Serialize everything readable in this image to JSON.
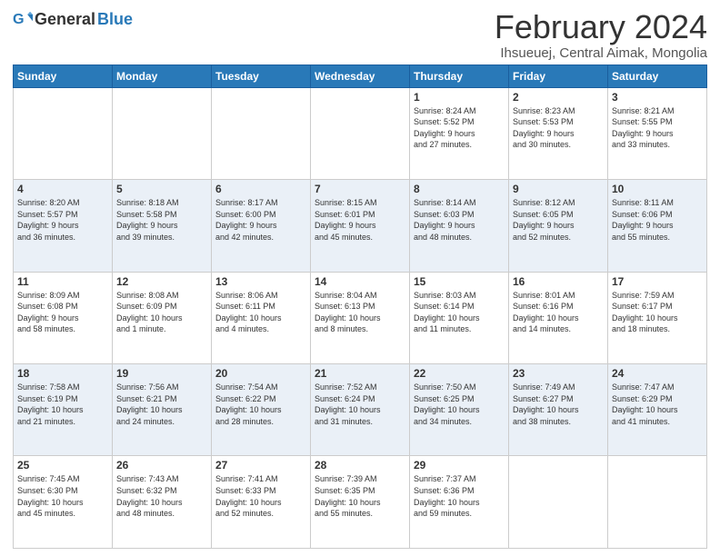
{
  "logo": {
    "general": "General",
    "blue": "Blue"
  },
  "header": {
    "title": "February 2024",
    "subtitle": "Ihsueuej, Central Aimak, Mongolia"
  },
  "weekdays": [
    "Sunday",
    "Monday",
    "Tuesday",
    "Wednesday",
    "Thursday",
    "Friday",
    "Saturday"
  ],
  "weeks": [
    [
      {
        "day": "",
        "info": ""
      },
      {
        "day": "",
        "info": ""
      },
      {
        "day": "",
        "info": ""
      },
      {
        "day": "",
        "info": ""
      },
      {
        "day": "1",
        "info": "Sunrise: 8:24 AM\nSunset: 5:52 PM\nDaylight: 9 hours\nand 27 minutes."
      },
      {
        "day": "2",
        "info": "Sunrise: 8:23 AM\nSunset: 5:53 PM\nDaylight: 9 hours\nand 30 minutes."
      },
      {
        "day": "3",
        "info": "Sunrise: 8:21 AM\nSunset: 5:55 PM\nDaylight: 9 hours\nand 33 minutes."
      }
    ],
    [
      {
        "day": "4",
        "info": "Sunrise: 8:20 AM\nSunset: 5:57 PM\nDaylight: 9 hours\nand 36 minutes."
      },
      {
        "day": "5",
        "info": "Sunrise: 8:18 AM\nSunset: 5:58 PM\nDaylight: 9 hours\nand 39 minutes."
      },
      {
        "day": "6",
        "info": "Sunrise: 8:17 AM\nSunset: 6:00 PM\nDaylight: 9 hours\nand 42 minutes."
      },
      {
        "day": "7",
        "info": "Sunrise: 8:15 AM\nSunset: 6:01 PM\nDaylight: 9 hours\nand 45 minutes."
      },
      {
        "day": "8",
        "info": "Sunrise: 8:14 AM\nSunset: 6:03 PM\nDaylight: 9 hours\nand 48 minutes."
      },
      {
        "day": "9",
        "info": "Sunrise: 8:12 AM\nSunset: 6:05 PM\nDaylight: 9 hours\nand 52 minutes."
      },
      {
        "day": "10",
        "info": "Sunrise: 8:11 AM\nSunset: 6:06 PM\nDaylight: 9 hours\nand 55 minutes."
      }
    ],
    [
      {
        "day": "11",
        "info": "Sunrise: 8:09 AM\nSunset: 6:08 PM\nDaylight: 9 hours\nand 58 minutes."
      },
      {
        "day": "12",
        "info": "Sunrise: 8:08 AM\nSunset: 6:09 PM\nDaylight: 10 hours\nand 1 minute."
      },
      {
        "day": "13",
        "info": "Sunrise: 8:06 AM\nSunset: 6:11 PM\nDaylight: 10 hours\nand 4 minutes."
      },
      {
        "day": "14",
        "info": "Sunrise: 8:04 AM\nSunset: 6:13 PM\nDaylight: 10 hours\nand 8 minutes."
      },
      {
        "day": "15",
        "info": "Sunrise: 8:03 AM\nSunset: 6:14 PM\nDaylight: 10 hours\nand 11 minutes."
      },
      {
        "day": "16",
        "info": "Sunrise: 8:01 AM\nSunset: 6:16 PM\nDaylight: 10 hours\nand 14 minutes."
      },
      {
        "day": "17",
        "info": "Sunrise: 7:59 AM\nSunset: 6:17 PM\nDaylight: 10 hours\nand 18 minutes."
      }
    ],
    [
      {
        "day": "18",
        "info": "Sunrise: 7:58 AM\nSunset: 6:19 PM\nDaylight: 10 hours\nand 21 minutes."
      },
      {
        "day": "19",
        "info": "Sunrise: 7:56 AM\nSunset: 6:21 PM\nDaylight: 10 hours\nand 24 minutes."
      },
      {
        "day": "20",
        "info": "Sunrise: 7:54 AM\nSunset: 6:22 PM\nDaylight: 10 hours\nand 28 minutes."
      },
      {
        "day": "21",
        "info": "Sunrise: 7:52 AM\nSunset: 6:24 PM\nDaylight: 10 hours\nand 31 minutes."
      },
      {
        "day": "22",
        "info": "Sunrise: 7:50 AM\nSunset: 6:25 PM\nDaylight: 10 hours\nand 34 minutes."
      },
      {
        "day": "23",
        "info": "Sunrise: 7:49 AM\nSunset: 6:27 PM\nDaylight: 10 hours\nand 38 minutes."
      },
      {
        "day": "24",
        "info": "Sunrise: 7:47 AM\nSunset: 6:29 PM\nDaylight: 10 hours\nand 41 minutes."
      }
    ],
    [
      {
        "day": "25",
        "info": "Sunrise: 7:45 AM\nSunset: 6:30 PM\nDaylight: 10 hours\nand 45 minutes."
      },
      {
        "day": "26",
        "info": "Sunrise: 7:43 AM\nSunset: 6:32 PM\nDaylight: 10 hours\nand 48 minutes."
      },
      {
        "day": "27",
        "info": "Sunrise: 7:41 AM\nSunset: 6:33 PM\nDaylight: 10 hours\nand 52 minutes."
      },
      {
        "day": "28",
        "info": "Sunrise: 7:39 AM\nSunset: 6:35 PM\nDaylight: 10 hours\nand 55 minutes."
      },
      {
        "day": "29",
        "info": "Sunrise: 7:37 AM\nSunset: 6:36 PM\nDaylight: 10 hours\nand 59 minutes."
      },
      {
        "day": "",
        "info": ""
      },
      {
        "day": "",
        "info": ""
      }
    ]
  ]
}
